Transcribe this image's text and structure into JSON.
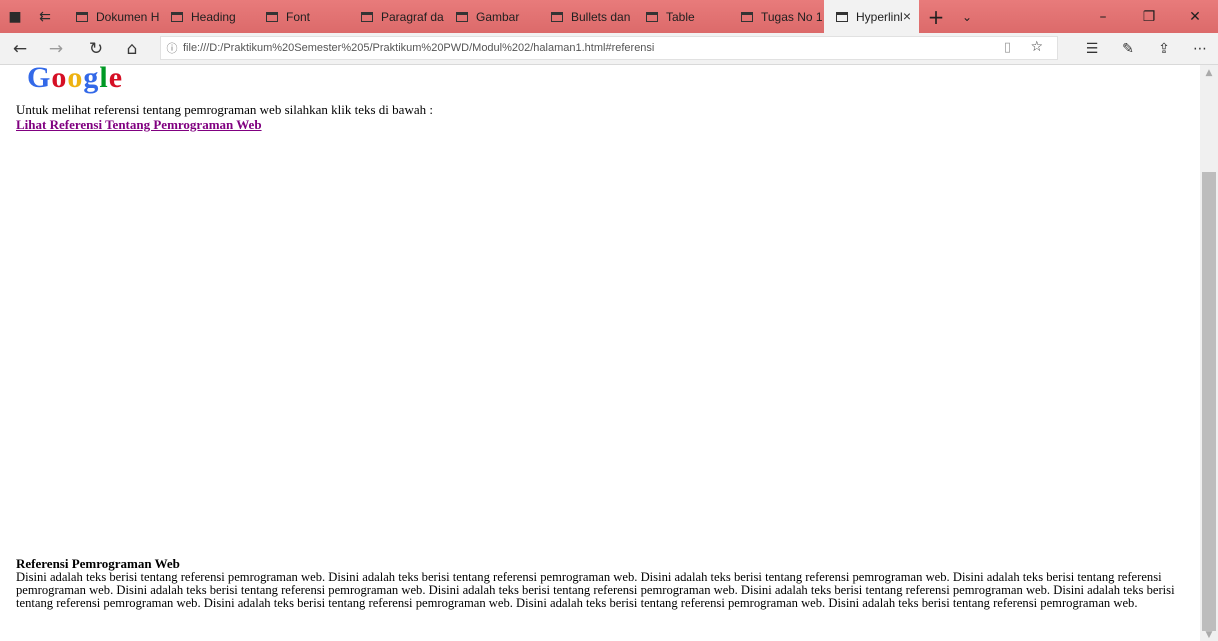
{
  "browser": {
    "tabs": [
      {
        "label": "Dokumen HT",
        "active": false
      },
      {
        "label": "Heading",
        "active": false
      },
      {
        "label": "Font",
        "active": false
      },
      {
        "label": "Paragraf dan",
        "active": false
      },
      {
        "label": "Gambar",
        "active": false
      },
      {
        "label": "Bullets dan N",
        "active": false
      },
      {
        "label": "Table",
        "active": false
      },
      {
        "label": "Tugas No 1",
        "active": false
      },
      {
        "label": "Hyperlinl",
        "active": true
      }
    ],
    "close_tab_glyph": "×",
    "new_tab_glyph": "+",
    "tab_list_glyph": "⌄",
    "url": "file:///D:/Praktikum%20Semester%205/Praktikum%20PWD/Modul%202/halaman1.html#referensi",
    "icons": [
      "set-aside-icon",
      "back-icon",
      "forward-icon",
      "refresh-icon",
      "home-icon",
      "info-icon",
      "reading-view-icon",
      "favorite-star-icon",
      "favorites-list-icon",
      "web-note-icon",
      "share-icon",
      "more-icon"
    ]
  },
  "page": {
    "logo": [
      "G",
      "o",
      "o",
      "g",
      "l",
      "e"
    ],
    "intro_text": "Untuk melihat referensi tentang pemrograman web silahkan klik teks di bawah :",
    "link_text": "Lihat Referensi Tentang Pemrograman Web",
    "section_title": "Referensi Pemrograman Web",
    "section_body": "Disini adalah teks berisi tentang referensi pemrograman web. Disini adalah teks berisi tentang referensi pemrograman web. Disini adalah teks berisi tentang referensi pemrograman web. Disini adalah teks berisi tentang referensi pemrograman web. Disini adalah teks berisi tentang referensi pemrograman web. Disini adalah teks berisi tentang referensi pemrograman web. Disini adalah teks berisi tentang referensi pemrograman web. Disini adalah teks berisi tentang referensi pemrograman web. Disini adalah teks berisi tentang referensi pemrograman web. Disini adalah teks berisi tentang referensi pemrograman web. Disini adalah teks berisi tentang referensi pemrograman web."
  },
  "colors": {
    "tabbar": "#e06b6b",
    "link_visited": "#800080"
  }
}
